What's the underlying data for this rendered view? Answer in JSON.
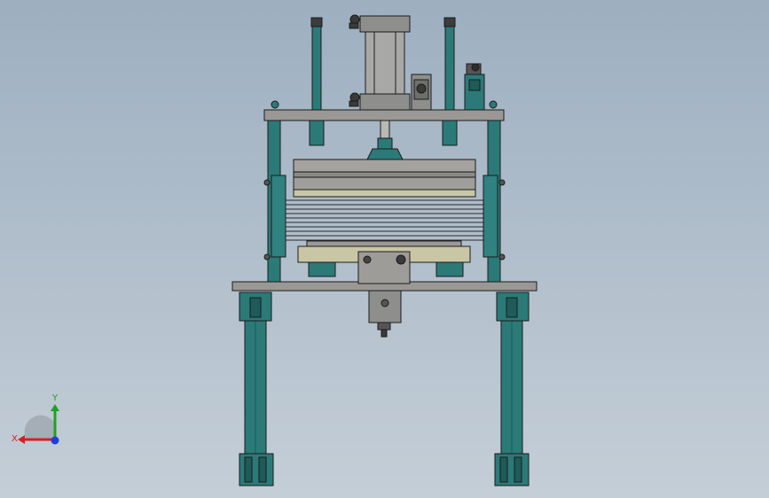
{
  "viewport": {
    "background_top": "#9dafc0",
    "background_bottom": "#c4ced7"
  },
  "model": {
    "frame_color": "#2b7a78",
    "plate_color": "#9a9894",
    "cylinder_color": "#8e8e8c",
    "outline_color": "#1b1b1b"
  },
  "triad": {
    "x_label": "X",
    "y_label": "Y",
    "x_color": "#d32020",
    "y_color": "#22a022",
    "z_color": "#1f3fd6"
  }
}
